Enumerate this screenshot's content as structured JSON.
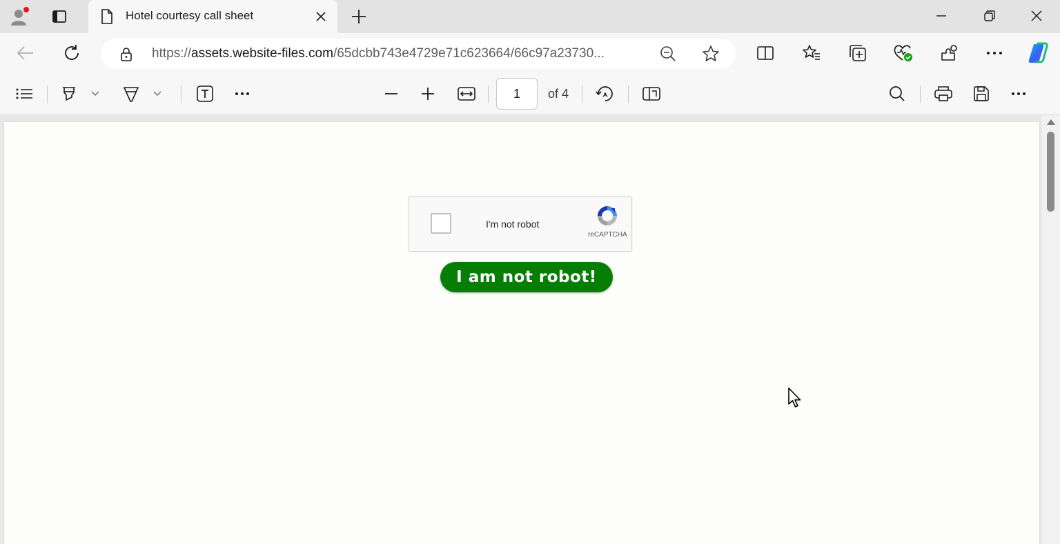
{
  "browser": {
    "tab": {
      "title": "Hotel courtesy call sheet"
    },
    "address": {
      "scheme": "https://",
      "host": "assets.website-files.com",
      "path": "/65dcbb743e4729e71c623664/66c97a23730..."
    }
  },
  "pdf_toolbar": {
    "page_current": "1",
    "page_total_label": "of 4"
  },
  "document": {
    "captcha": {
      "label": "I'm not robot",
      "brand": "reCAPTCHA"
    },
    "button_label": "I am not robot!"
  },
  "colors": {
    "button_green": "#067e06",
    "tabstrip_bg": "#e3e3e3",
    "toolbar_bg": "#f7f7f7"
  },
  "icons": [
    "profile-icon",
    "tab-actions-icon",
    "document-icon",
    "close-icon",
    "plus-icon",
    "minimize-icon",
    "restore-icon",
    "back-arrow-icon",
    "refresh-icon",
    "lock-icon",
    "zoom-out-icon",
    "star-icon",
    "split-screen-icon",
    "favorites-icon",
    "collections-icon",
    "browser-essentials-icon",
    "extensions-icon",
    "more-icon",
    "copilot-icon",
    "contents-icon",
    "highlight-icon",
    "draw-icon",
    "text-icon",
    "minus-icon",
    "fit-width-icon",
    "rotate-icon",
    "page-view-icon",
    "search-icon",
    "print-icon",
    "save-icon"
  ]
}
